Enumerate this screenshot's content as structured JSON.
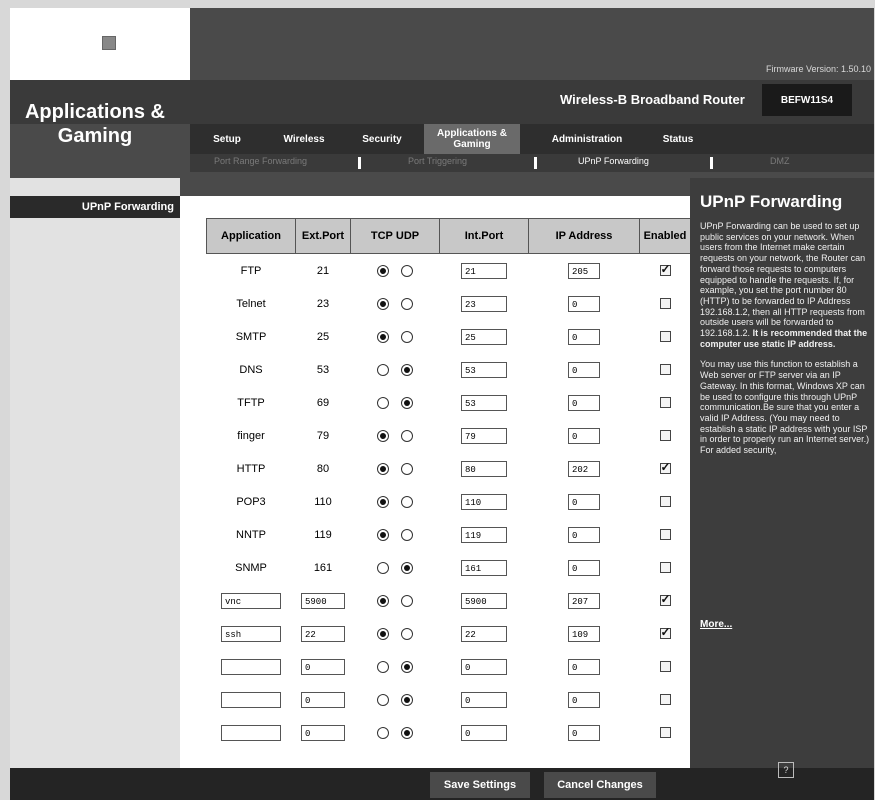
{
  "header": {
    "section_title": "Applications & Gaming",
    "firmware": "Firmware Version: 1.50.10",
    "product": "Wireless-B Broadband Router",
    "model": "BEFW11S4"
  },
  "tabs": [
    {
      "label": "Setup"
    },
    {
      "label": "Wireless"
    },
    {
      "label": "Security"
    },
    {
      "label": "Applications & Gaming"
    },
    {
      "label": "Administration"
    },
    {
      "label": "Status"
    }
  ],
  "subtabs": [
    {
      "label": "Port Range Forwarding"
    },
    {
      "label": "Port Triggering"
    },
    {
      "label": "UPnP Forwarding"
    },
    {
      "label": "DMZ"
    }
  ],
  "sidebar": {
    "title": "UPnP Forwarding"
  },
  "table": {
    "headers": [
      "Application",
      "Ext.Port",
      "TCP",
      "UDP",
      "Int.Port",
      "IP Address",
      "Enabled"
    ],
    "rows": [
      {
        "app": "FTP",
        "ext": "21",
        "proto": "TCP",
        "int": "21",
        "ip": "205",
        "enabled": true,
        "editable": false
      },
      {
        "app": "Telnet",
        "ext": "23",
        "proto": "TCP",
        "int": "23",
        "ip": "0",
        "enabled": false,
        "editable": false
      },
      {
        "app": "SMTP",
        "ext": "25",
        "proto": "TCP",
        "int": "25",
        "ip": "0",
        "enabled": false,
        "editable": false
      },
      {
        "app": "DNS",
        "ext": "53",
        "proto": "UDP",
        "int": "53",
        "ip": "0",
        "enabled": false,
        "editable": false
      },
      {
        "app": "TFTP",
        "ext": "69",
        "proto": "UDP",
        "int": "53",
        "ip": "0",
        "enabled": false,
        "editable": false
      },
      {
        "app": "finger",
        "ext": "79",
        "proto": "TCP",
        "int": "79",
        "ip": "0",
        "enabled": false,
        "editable": false
      },
      {
        "app": "HTTP",
        "ext": "80",
        "proto": "TCP",
        "int": "80",
        "ip": "202",
        "enabled": true,
        "editable": false
      },
      {
        "app": "POP3",
        "ext": "110",
        "proto": "TCP",
        "int": "110",
        "ip": "0",
        "enabled": false,
        "editable": false
      },
      {
        "app": "NNTP",
        "ext": "119",
        "proto": "TCP",
        "int": "119",
        "ip": "0",
        "enabled": false,
        "editable": false
      },
      {
        "app": "SNMP",
        "ext": "161",
        "proto": "UDP",
        "int": "161",
        "ip": "0",
        "enabled": false,
        "editable": false
      },
      {
        "app": "vnc",
        "ext": "5900",
        "proto": "TCP",
        "int": "5900",
        "ip": "207",
        "enabled": true,
        "editable": true
      },
      {
        "app": "ssh",
        "ext": "22",
        "proto": "TCP",
        "int": "22",
        "ip": "109",
        "enabled": true,
        "editable": true
      },
      {
        "app": "",
        "ext": "0",
        "proto": "UDP",
        "int": "0",
        "ip": "0",
        "enabled": false,
        "editable": true
      },
      {
        "app": "",
        "ext": "0",
        "proto": "UDP",
        "int": "0",
        "ip": "0",
        "enabled": false,
        "editable": true
      },
      {
        "app": "",
        "ext": "0",
        "proto": "UDP",
        "int": "0",
        "ip": "0",
        "enabled": false,
        "editable": true
      }
    ]
  },
  "help": {
    "title": "UPnP Forwarding",
    "para1": "UPnP Forwarding can be used to set up public services on your network. When users from the Internet make certain requests on your network, the Router can forward those requests to computers equipped to handle the requests. If, for example, you set the port number 80 (HTTP) to be forwarded to IP Address 192.168.1.2, then all HTTP requests from outside users will be forwarded to 192.168.1.2.",
    "para1_bold": "It is recommended that the computer use static IP address.",
    "para2": "You may use this function to establish a Web server or FTP server via an IP Gateway. In this format, Windows XP can be used to configure this through UPnP communication.Be sure that you enter a valid IP Address. (You may need to establish a static IP address with your ISP in order to properly run an Internet server.) For added security,",
    "more": "More..."
  },
  "footer": {
    "save": "Save Settings",
    "cancel": "Cancel Changes"
  },
  "icons": {
    "logo": "router-logo-icon",
    "help": "help-icon"
  }
}
